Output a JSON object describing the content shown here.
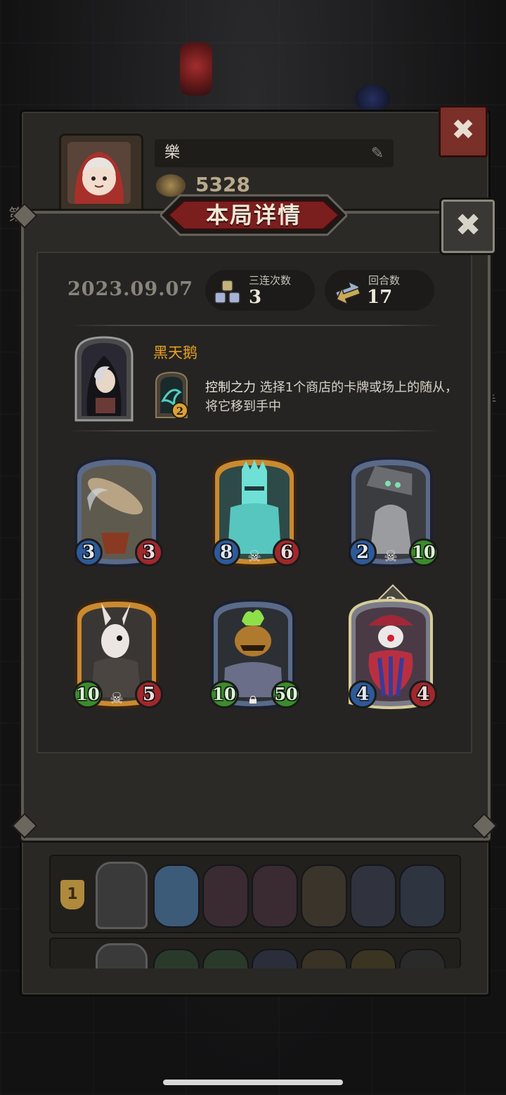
{
  "background": {
    "profile_name": "樂",
    "profile_score": "5328",
    "left_edge_text": "第",
    "right_edge_text": "手",
    "list_rows": [
      {
        "rank": "1"
      },
      {
        "rank": ""
      }
    ]
  },
  "dialog": {
    "title": "本局详情",
    "close_icon": "close-icon",
    "date": "2023.09.07",
    "stats": [
      {
        "label": "三连次数",
        "value": "3",
        "icon": "triple-stack-icon"
      },
      {
        "label": "回合数",
        "value": "17",
        "icon": "turn-cycle-icon"
      }
    ],
    "hero": {
      "name": "黑天鹅",
      "skill_name": "控制之力",
      "skill_description": " 选择1个商店的卡牌或场上的随从，将它移到手中",
      "skill_cost": "2"
    },
    "minions": [
      {
        "name": "airship",
        "attack": "3",
        "health": "3",
        "frame": "silver",
        "tier_icon": ""
      },
      {
        "name": "spiked-knight",
        "attack": "8",
        "health": "6",
        "frame": "gold",
        "tier_icon": "skull-icon"
      },
      {
        "name": "robot-bell",
        "attack": "2",
        "health": "10",
        "frame": "silver",
        "tier_icon": "skull-icon"
      },
      {
        "name": "rabbit-butcher",
        "attack": "10",
        "health": "5",
        "frame": "gold",
        "tier_icon": "skull-icon"
      },
      {
        "name": "pumpkin-brute",
        "attack": "10",
        "health": "50",
        "frame": "silver",
        "tier_icon": "lock-icon"
      },
      {
        "name": "clown",
        "attack": "4",
        "health": "4",
        "frame": "silver-glow",
        "tier_icon": "",
        "level": "2"
      }
    ]
  },
  "colors": {
    "accent_gold": "#e8a020",
    "banner_red": "#7a1e1e",
    "attack_blue": "#2e5a9a",
    "health_red": "#a0282c",
    "health_green": "#3b8c2c"
  }
}
